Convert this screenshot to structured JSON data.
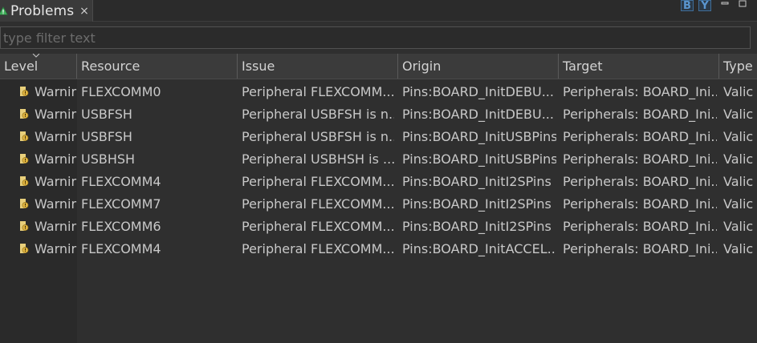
{
  "tab": {
    "title": "Problems",
    "icon": "problems-warning-icon",
    "close": "×"
  },
  "toolbar": {
    "btn_b": "B",
    "btn_y": "Y",
    "minimize": "▭",
    "maximize": "▭"
  },
  "filter": {
    "placeholder": "type filter text",
    "value": ""
  },
  "columns": [
    "Level",
    "Resource",
    "Issue",
    "Origin",
    "Target",
    "Type"
  ],
  "sort": {
    "column": "Level",
    "direction": "descending"
  },
  "rows": [
    {
      "level": "Warnir",
      "resource": "FLEXCOMM0",
      "issue": "Peripheral FLEXCOMM...",
      "origin": "Pins:BOARD_InitDEBU...",
      "target": "Peripherals: BOARD_Ini...",
      "type": "Valic"
    },
    {
      "level": "Warnir",
      "resource": "USBFSH",
      "issue": "Peripheral USBFSH is n...",
      "origin": "Pins:BOARD_InitDEBU...",
      "target": "Peripherals: BOARD_Ini...",
      "type": "Valic"
    },
    {
      "level": "Warnir",
      "resource": "USBFSH",
      "issue": "Peripheral USBFSH is n...",
      "origin": "Pins:BOARD_InitUSBPins",
      "target": "Peripherals: BOARD_Ini...",
      "type": "Valic"
    },
    {
      "level": "Warnir",
      "resource": "USBHSH",
      "issue": "Peripheral USBHSH is ...",
      "origin": "Pins:BOARD_InitUSBPins",
      "target": "Peripherals: BOARD_Ini...",
      "type": "Valic"
    },
    {
      "level": "Warnir",
      "resource": "FLEXCOMM4",
      "issue": "Peripheral FLEXCOMM...",
      "origin": "Pins:BOARD_InitI2SPins",
      "target": "Peripherals: BOARD_Ini...",
      "type": "Valic"
    },
    {
      "level": "Warnir",
      "resource": "FLEXCOMM7",
      "issue": "Peripheral FLEXCOMM...",
      "origin": "Pins:BOARD_InitI2SPins",
      "target": "Peripherals: BOARD_Ini...",
      "type": "Valic"
    },
    {
      "level": "Warnir",
      "resource": "FLEXCOMM6",
      "issue": "Peripheral FLEXCOMM...",
      "origin": "Pins:BOARD_InitI2SPins",
      "target": "Peripherals: BOARD_Ini...",
      "type": "Valic"
    },
    {
      "level": "Warnir",
      "resource": "FLEXCOMM4",
      "issue": "Peripheral FLEXCOMM...",
      "origin": "Pins:BOARD_InitACCEL...",
      "target": "Peripherals: BOARD_Ini...",
      "type": "Valic"
    }
  ],
  "colors": {
    "warning": "#e0b441",
    "accent": "#5a96d0",
    "background": "#2f2f2f"
  }
}
